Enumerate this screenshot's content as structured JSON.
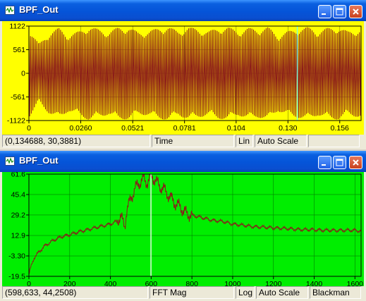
{
  "windows": [
    {
      "title": "BPF_Out",
      "icon": "waveform-icon",
      "plot": {
        "background": "#ffff00",
        "trace_color": "#8b1a1a",
        "grid_color": "#808000",
        "cursor_color": "#7fffd4"
      },
      "status": {
        "coords": "(0,134688, 30,3881)",
        "x_quantity": "Time",
        "scale_mode": "Lin",
        "auto_scale": "Auto Scale",
        "window_fn": ""
      },
      "chart_data": {
        "type": "line",
        "xlabel": "Time",
        "ylabel": "",
        "xlim": [
          0,
          0.1667
        ],
        "ylim": [
          -1122,
          1122
        ],
        "x_ticks": [
          "0",
          "0.0260",
          "0.0521",
          "0.0781",
          "0.104",
          "0.130",
          "0.156"
        ],
        "y_ticks": [
          "1122",
          "561",
          "0",
          "-561",
          "-1122"
        ],
        "grid": true,
        "cursor_x": 0.1347,
        "series": [
          {
            "signal": "oscillating",
            "amplitude_envelope": [
              [
                0.0,
                1050
              ],
              [
                0.005,
                700
              ],
              [
                0.01,
                950
              ],
              [
                0.015,
                1080
              ],
              [
                0.02,
                900
              ],
              [
                0.025,
                1000
              ],
              [
                0.03,
                1110
              ],
              [
                0.035,
                1050
              ],
              [
                0.04,
                980
              ],
              [
                0.045,
                1100
              ],
              [
                0.05,
                1090
              ],
              [
                0.055,
                980
              ],
              [
                0.06,
                1000
              ],
              [
                0.065,
                1080
              ],
              [
                0.07,
                1110
              ],
              [
                0.075,
                1000
              ],
              [
                0.08,
                1100
              ],
              [
                0.085,
                1050
              ],
              [
                0.09,
                1000
              ],
              [
                0.095,
                1080
              ],
              [
                0.1,
                1100
              ],
              [
                0.105,
                1000
              ],
              [
                0.11,
                1080
              ],
              [
                0.115,
                1050
              ],
              [
                0.12,
                1100
              ],
              [
                0.125,
                900
              ],
              [
                0.13,
                1000
              ],
              [
                0.135,
                1060
              ],
              [
                0.14,
                1100
              ],
              [
                0.145,
                1000
              ],
              [
                0.15,
                1080
              ],
              [
                0.155,
                1100
              ],
              [
                0.16,
                1000
              ],
              [
                0.1667,
                1050
              ]
            ]
          }
        ]
      }
    },
    {
      "title": "BPF_Out",
      "icon": "waveform-icon",
      "plot": {
        "background": "#00ee00",
        "trace_color": "#8b1a1a",
        "grid_color": "#008000",
        "cursor_color": "#e0ffe0"
      },
      "status": {
        "coords": "(598,633, 44,2508)",
        "x_quantity": "FFT Mag",
        "scale_mode": "Log",
        "auto_scale": "Auto Scale",
        "window_fn": "Blackman"
      },
      "chart_data": {
        "type": "line",
        "xlabel": "FFT Mag",
        "ylabel": "",
        "xlim": [
          0,
          1630
        ],
        "ylim": [
          -19.5,
          61.6
        ],
        "x_ticks": [
          "0",
          "200",
          "400",
          "600",
          "800",
          "1000",
          "1200",
          "1400",
          "1600"
        ],
        "y_ticks": [
          "61.6",
          "45.4",
          "29.2",
          "12.9",
          "-3.30",
          "-19.5"
        ],
        "grid": true,
        "cursor_x": 599,
        "series": [
          {
            "points": [
              [
                0,
                -18
              ],
              [
                10,
                -12
              ],
              [
                25,
                -5
              ],
              [
                50,
                0
              ],
              [
                80,
                5
              ],
              [
                120,
                9
              ],
              [
                160,
                12
              ],
              [
                200,
                13.5
              ],
              [
                250,
                16
              ],
              [
                300,
                18
              ],
              [
                350,
                20
              ],
              [
                400,
                22
              ],
              [
                430,
                24
              ],
              [
                450,
                28
              ],
              [
                470,
                20
              ],
              [
                480,
                33
              ],
              [
                500,
                42
              ],
              [
                520,
                50
              ],
              [
                540,
                54
              ],
              [
                560,
                58
              ],
              [
                580,
                55
              ],
              [
                600,
                60
              ],
              [
                620,
                57
              ],
              [
                640,
                52
              ],
              [
                660,
                50
              ],
              [
                680,
                46
              ],
              [
                700,
                42
              ],
              [
                720,
                38
              ],
              [
                740,
                36
              ],
              [
                760,
                32
              ],
              [
                780,
                30
              ],
              [
                800,
                29
              ],
              [
                850,
                27
              ],
              [
                900,
                25
              ],
              [
                950,
                24
              ],
              [
                1000,
                22
              ],
              [
                1050,
                21
              ],
              [
                1100,
                20
              ],
              [
                1150,
                19.5
              ],
              [
                1200,
                19
              ],
              [
                1250,
                18.5
              ],
              [
                1300,
                18
              ],
              [
                1350,
                17.5
              ],
              [
                1400,
                17.5
              ],
              [
                1450,
                17
              ],
              [
                1500,
                17
              ],
              [
                1550,
                17
              ],
              [
                1600,
                17
              ],
              [
                1630,
                16.5
              ]
            ]
          }
        ]
      }
    }
  ]
}
